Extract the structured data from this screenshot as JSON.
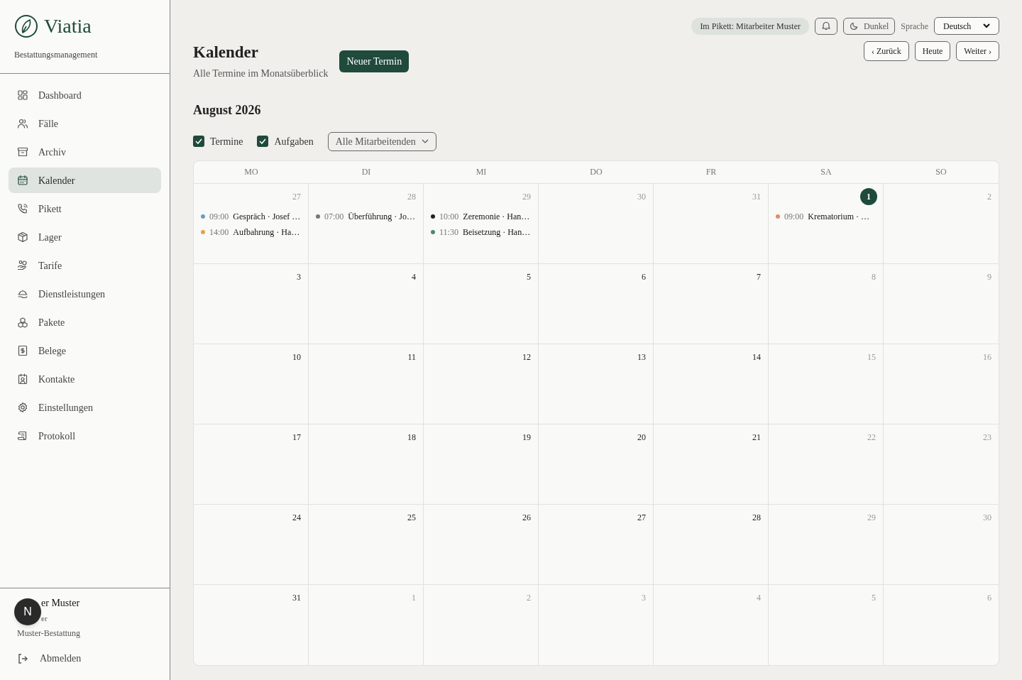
{
  "brand": {
    "name": "Viatia",
    "tagline": "Bestattungsmanagement"
  },
  "nav": [
    {
      "label": "Dashboard",
      "selected": false
    },
    {
      "label": "Fälle",
      "selected": false
    },
    {
      "label": "Archiv",
      "selected": false
    },
    {
      "label": "Kalender",
      "selected": true
    },
    {
      "label": "Pikett",
      "selected": false
    },
    {
      "label": "Lager",
      "selected": false
    },
    {
      "label": "Tarife",
      "selected": false
    },
    {
      "label": "Dienstleistungen",
      "selected": false
    },
    {
      "label": "Pakete",
      "selected": false
    },
    {
      "label": "Belege",
      "selected": false
    },
    {
      "label": "Kontakte",
      "selected": false
    },
    {
      "label": "Einstellungen",
      "selected": false
    },
    {
      "label": "Protokoll",
      "selected": false
    }
  ],
  "user": {
    "name": "er Muster",
    "role": "er",
    "company": "Muster-Bestattung",
    "avatar": "N",
    "logout": "Abmelden"
  },
  "topbar": {
    "on_call": "Im Pikett: Mitarbeiter Muster",
    "theme": "Dunkel",
    "language_label": "Sprache",
    "language": "Deutsch"
  },
  "header": {
    "title": "Kalender",
    "subtitle": "Alle Termine im Monatsüberblick",
    "new_button": "Neuer Termin",
    "nav_buttons": [
      "‹ Zurück",
      "Heute",
      "Weiter ›"
    ]
  },
  "month": "August 2026",
  "filters": {
    "checkboxes": [
      {
        "label": "Termine",
        "checked": true
      },
      {
        "label": "Aufgaben",
        "checked": true
      }
    ],
    "staff_select": "Alle Mitarbeitenden"
  },
  "weekdays": [
    "MO",
    "DI",
    "MI",
    "DO",
    "FR",
    "SA",
    "SO"
  ],
  "days": [
    {
      "number": "27",
      "muted": true,
      "today": false,
      "events": [
        {
          "time": "09:00",
          "title": "Gespräch · Josef …",
          "color": "#6b9bc3"
        },
        {
          "time": "14:00",
          "title": "Aufbahrung · Ha…",
          "color": "#e8a050"
        }
      ]
    },
    {
      "number": "28",
      "muted": true,
      "today": false,
      "events": [
        {
          "time": "07:00",
          "title": "Überführung · Jo…",
          "color": "#777777"
        }
      ]
    },
    {
      "number": "29",
      "muted": true,
      "today": false,
      "events": [
        {
          "time": "10:00",
          "title": "Zeremonie · Han…",
          "color": "#222222"
        },
        {
          "time": "11:30",
          "title": "Beisetzung · Han…",
          "color": "#4a8a70"
        }
      ]
    },
    {
      "number": "30",
      "muted": true,
      "today": false
    },
    {
      "number": "31",
      "muted": true,
      "today": false
    },
    {
      "number": "1",
      "today": true,
      "events": [
        {
          "time": "09:00",
          "title": "Krematorium · …",
          "color": "#e08a70"
        }
      ]
    },
    {
      "number": "2",
      "muted": true,
      "today": false
    },
    {
      "number": "3",
      "muted": false,
      "today": false
    },
    {
      "number": "4",
      "muted": false,
      "today": false
    },
    {
      "number": "5",
      "muted": false,
      "today": false
    },
    {
      "number": "6",
      "muted": false,
      "today": false
    },
    {
      "number": "7",
      "muted": false,
      "today": false
    },
    {
      "number": "8",
      "muted": true,
      "today": false
    },
    {
      "number": "9",
      "muted": true,
      "today": false
    },
    {
      "number": "10",
      "muted": false,
      "today": false
    },
    {
      "number": "11",
      "muted": false,
      "today": false
    },
    {
      "number": "12",
      "muted": false,
      "today": false
    },
    {
      "number": "13",
      "muted": false,
      "today": false
    },
    {
      "number": "14",
      "muted": false,
      "today": false
    },
    {
      "number": "15",
      "muted": true,
      "today": false
    },
    {
      "number": "16",
      "muted": true,
      "today": false
    },
    {
      "number": "17",
      "muted": false,
      "today": false
    },
    {
      "number": "18",
      "muted": false,
      "today": false
    },
    {
      "number": "19",
      "muted": false,
      "today": false
    },
    {
      "number": "20",
      "muted": false,
      "today": false
    },
    {
      "number": "21",
      "muted": false,
      "today": false
    },
    {
      "number": "22",
      "muted": true,
      "today": false
    },
    {
      "number": "23",
      "muted": true,
      "today": false
    },
    {
      "number": "24",
      "muted": false,
      "today": false
    },
    {
      "number": "25",
      "muted": false,
      "today": false
    },
    {
      "number": "26",
      "muted": false,
      "today": false
    },
    {
      "number": "27",
      "muted": false,
      "today": false
    },
    {
      "number": "28",
      "muted": false,
      "today": false
    },
    {
      "number": "29",
      "muted": true,
      "today": false
    },
    {
      "number": "30",
      "muted": true,
      "today": false
    },
    {
      "number": "31",
      "muted": false,
      "today": false
    },
    {
      "number": "1",
      "muted": true,
      "today": false
    },
    {
      "number": "2",
      "muted": true,
      "today": false
    },
    {
      "number": "3",
      "muted": true,
      "today": false
    },
    {
      "number": "4",
      "muted": true,
      "today": false
    },
    {
      "number": "5",
      "muted": true,
      "today": false
    },
    {
      "number": "6",
      "muted": true,
      "today": false
    }
  ]
}
